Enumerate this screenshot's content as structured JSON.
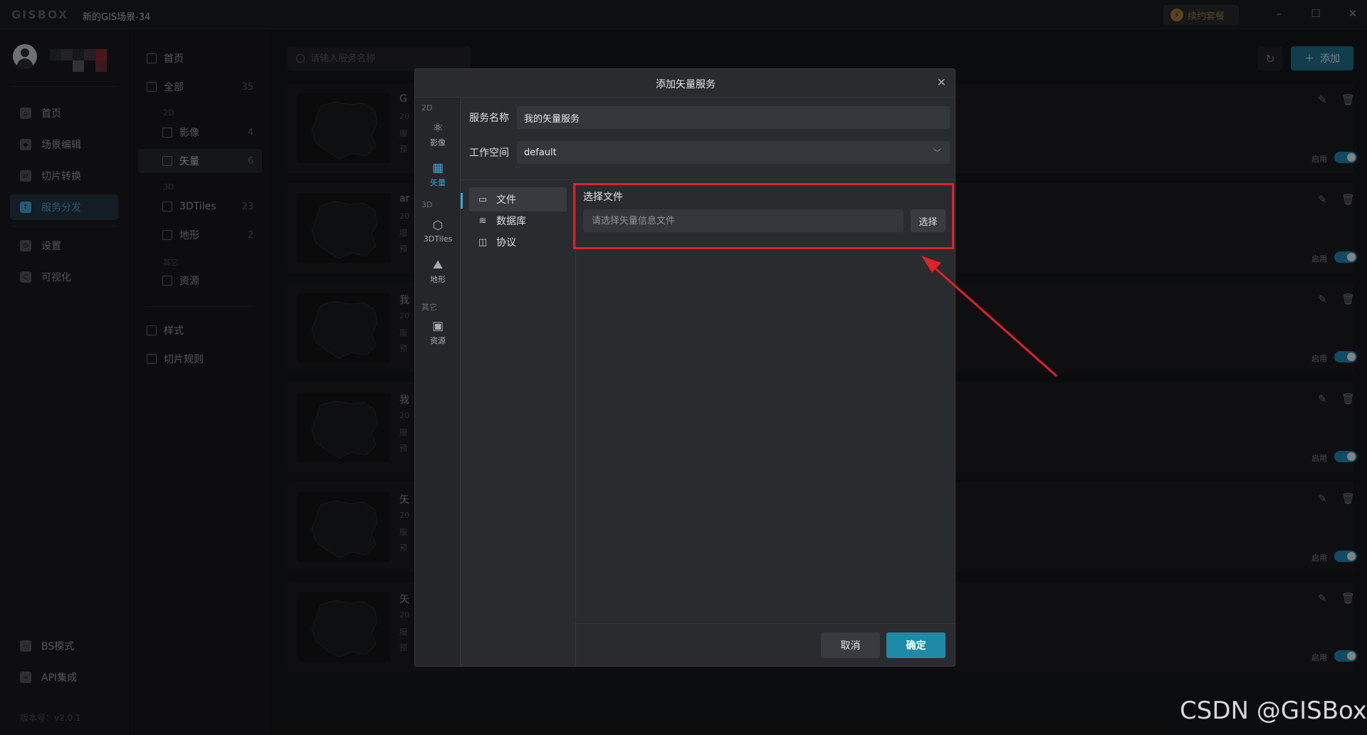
{
  "app": {
    "logo": "GISBOX",
    "doc_title": "新的GIS场景-34",
    "renew_label": "续约套餐",
    "version": "版本号：v2.0.1"
  },
  "rail": {
    "items": [
      {
        "label": "首页",
        "icon": "home-icon"
      },
      {
        "label": "场景编辑",
        "icon": "cube-icon"
      },
      {
        "label": "切片转换",
        "icon": "swap-icon"
      },
      {
        "label": "服务分发",
        "icon": "upload-icon",
        "active": true
      },
      {
        "label": "设置",
        "icon": "gear-icon"
      },
      {
        "label": "可视化",
        "icon": "chart-icon"
      },
      {
        "label": "BS模式",
        "icon": "code-icon"
      },
      {
        "label": "API集成",
        "icon": "link-icon"
      }
    ]
  },
  "subnav": {
    "home": "首页",
    "all": {
      "label": "全部",
      "count": "35"
    },
    "group_2d": "2D",
    "imagery": {
      "label": "影像",
      "count": "4"
    },
    "vector": {
      "label": "矢量",
      "count": "6"
    },
    "group_3d": "3D",
    "tiles3d": {
      "label": "3DTiles",
      "count": "23"
    },
    "terrain": {
      "label": "地形",
      "count": "2"
    },
    "group_other": "其它",
    "resource": {
      "label": "资源"
    },
    "style": "样式",
    "slice_rule": "切片规则"
  },
  "main": {
    "search_placeholder": "请输入服务名称",
    "add_label": "添加",
    "enable_label": "启用",
    "cards": [
      {
        "name": "G"
      },
      {
        "name": "ar"
      },
      {
        "name": "我"
      },
      {
        "name": "我"
      },
      {
        "name": "矢"
      },
      {
        "name": "矢"
      }
    ],
    "meta_lines": [
      "20",
      "服",
      "预"
    ]
  },
  "dialog": {
    "title": "添加矢量服务",
    "rail_groups": {
      "g2d": "2D",
      "g3d": "3D",
      "other": "其它"
    },
    "rail_items": {
      "imagery": "影像",
      "vector": "矢量",
      "tiles3d": "3DTiles",
      "terrain": "地形",
      "resource": "资源"
    },
    "service_name_label": "服务名称",
    "service_name_value": "我的矢量服务",
    "workspace_label": "工作空间",
    "workspace_value": "default",
    "sources": {
      "file": "文件",
      "database": "数据库",
      "protocol": "协议"
    },
    "file_section_label": "选择文件",
    "file_placeholder": "请选择矢量信息文件",
    "choose_label": "选择",
    "cancel_label": "取消",
    "ok_label": "确定"
  },
  "colors": {
    "accent": "#1e8aa8",
    "highlight": "#e0202a"
  },
  "watermark": "CSDN @GISBox"
}
